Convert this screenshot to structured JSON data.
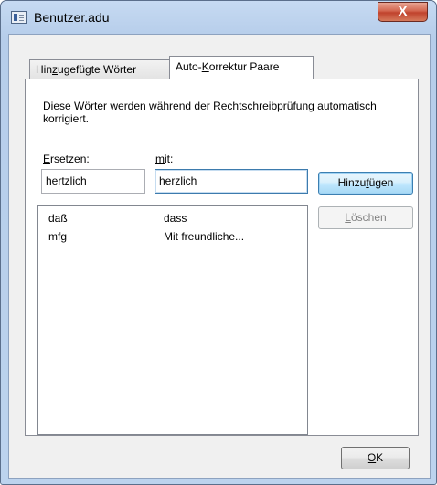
{
  "window": {
    "title": "Benutzer.adu",
    "close_label": "X"
  },
  "tabs": [
    {
      "label_pre": "Hin",
      "label_key": "z",
      "label_post": "ugefügte Wörter",
      "selected": false
    },
    {
      "label_pre": "Auto-",
      "label_key": "K",
      "label_post": "orrektur Paare",
      "selected": true
    }
  ],
  "panel": {
    "description": "Diese Wörter werden während der Rechtschreibprüfung automatisch korrigiert.",
    "replace_label_key": "E",
    "replace_label_post": "rsetzen:",
    "with_label_key": "m",
    "with_label_post": "it:",
    "replace_value": "hertzlich",
    "with_value": "herzlich"
  },
  "buttons": {
    "add_pre": "Hinzu",
    "add_key": "f",
    "add_post": "ügen",
    "delete_key": "L",
    "delete_post": "öschen",
    "ok_key": "O",
    "ok_post": "K"
  },
  "list": {
    "rows": [
      {
        "word": "daß",
        "replacement": "dass"
      },
      {
        "word": "mfg",
        "replacement": "Mit freundliche..."
      }
    ]
  }
}
